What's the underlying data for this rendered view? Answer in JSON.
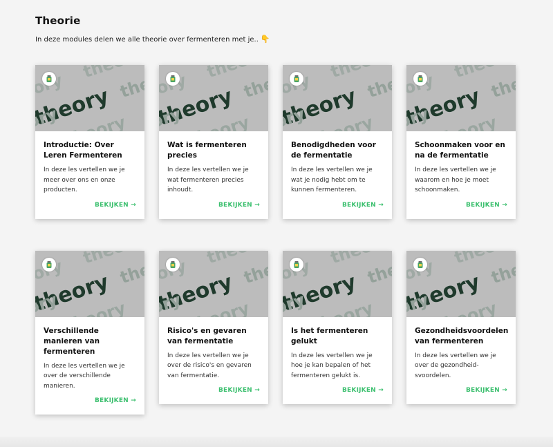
{
  "header": {
    "title": "Theorie",
    "subtitle": "In deze modules delen we alle theorie over fermenteren met je..",
    "subtitle_icon": "pointing-down-icon"
  },
  "image_word": "theory",
  "colors": {
    "link": "#3bbf6e",
    "card_bg": "#ffffff",
    "page_bg": "#f4f4f4"
  },
  "cards": [
    {
      "title": "Introductie: Over Leren Fermenteren",
      "description": "In deze les vertellen we je meer over ons en onze producten.",
      "link": "BEKIJKEN →"
    },
    {
      "title": "Wat is fermenteren precies",
      "description": "In deze les vertellen we je wat fermenteren precies inhoudt.",
      "link": "BEKIJKEN →"
    },
    {
      "title": "Benodigdheden voor de fermentatie",
      "description": "In deze les vertellen we je wat je nodig hebt om te kunnen fermenteren.",
      "link": "BEKIJKEN →"
    },
    {
      "title": "Schoonmaken voor en na de fermentatie",
      "description": "In deze les vertellen we je waarom en hoe je moet schoonmaken.",
      "link": "BEKIJKEN →"
    },
    {
      "title": "Verschillende manieren van fermenteren",
      "description": "In deze les vertellen we je over de verschillende manieren.",
      "link": "BEKIJKEN →"
    },
    {
      "title": "Risico's en gevaren van fermentatie",
      "description": "In deze les vertellen we je over de risico's en gevaren van fermentatie.",
      "link": "BEKIJKEN →"
    },
    {
      "title": "Is het fermenteren gelukt",
      "description": "In deze les vertellen we je hoe je kan bepalen of het fermenteren gelukt is.",
      "link": "BEKIJKEN →"
    },
    {
      "title": "Gezondheidsvoordelen van fermenteren",
      "description": "In deze les vertellen we je over de gezondheid-svoordelen.",
      "link": "BEKIJKEN →"
    }
  ]
}
